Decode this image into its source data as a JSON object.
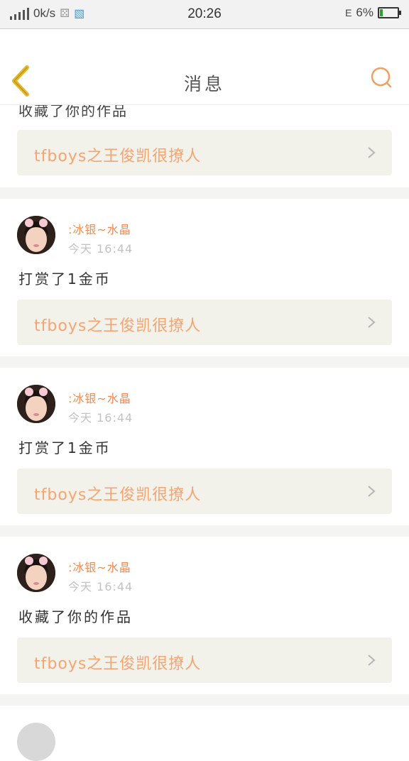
{
  "status_bar": {
    "speed": "0k/s",
    "time": "20:26",
    "network": "E",
    "battery": "6%"
  },
  "nav": {
    "title": "消息"
  },
  "partial_item": {
    "action": "收藏了你的作品",
    "work_title": "tfboys之王俊凯很撩人"
  },
  "items": [
    {
      "username": ":冰银~水晶",
      "time": "今天 16:44",
      "action": "打赏了1金币",
      "work_title": "tfboys之王俊凯很撩人"
    },
    {
      "username": ":冰银~水晶",
      "time": "今天 16:44",
      "action": "打赏了1金币",
      "work_title": "tfboys之王俊凯很撩人"
    },
    {
      "username": ":冰银~水晶",
      "time": "今天 16:44",
      "action": "收藏了你的作品",
      "work_title": "tfboys之王俊凯很撩人"
    }
  ],
  "colors": {
    "accent": "#f08a4b",
    "work_title": "#f5a572",
    "card_bg": "#f2f1ea",
    "back_icon": "#e2b72a"
  },
  "icons": [
    "back-arrow-icon",
    "search-icon",
    "chevron-right-icon",
    "signal-icon",
    "battery-icon"
  ]
}
